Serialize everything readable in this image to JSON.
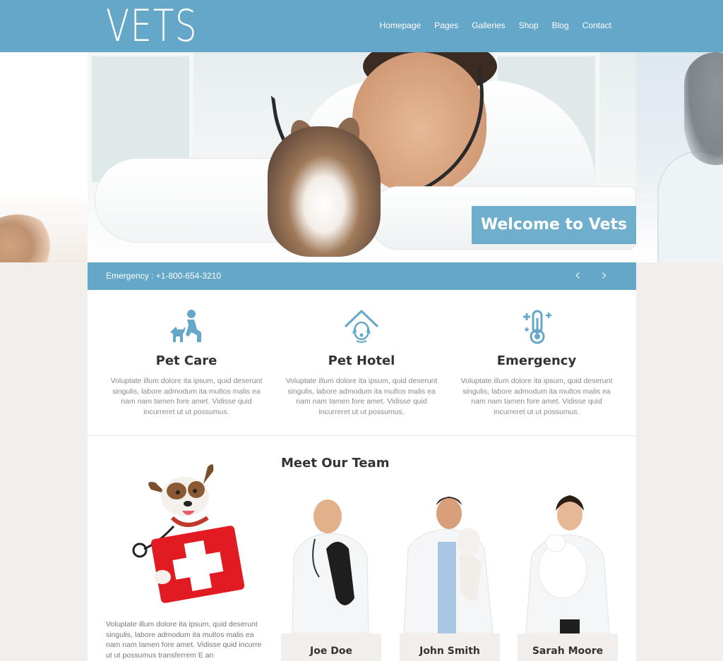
{
  "header": {
    "logo": "VETS",
    "nav": [
      "Homepage",
      "Pages",
      "Galleries",
      "Shop",
      "Blog",
      "Contact"
    ]
  },
  "hero": {
    "welcome": "Welcome to Vets"
  },
  "bar": {
    "phone": "Emergency : +1-800-654-3210",
    "prev_icon": "chevron-left-icon",
    "next_icon": "chevron-right-icon"
  },
  "services": [
    {
      "title": "Pet Care",
      "icon": "person-with-dog-icon",
      "text": "Voluptate illum dolore ita ipsum, quid deserunt singulis, labore admodum ita multos malis ea nam nam tamen fore amet. Vidisse quid incurreret ut ut possumus."
    },
    {
      "title": "Pet Hotel",
      "icon": "dog-house-icon",
      "text": "Voluptate illum dolore ita ipsum, quid deserunt singulis, labore admodum ita multos malis ea nam nam tamen fore amet. Vidisse quid incurreret ut ut possumus."
    },
    {
      "title": "Emergency",
      "icon": "thermometer-icon",
      "text": "Voluptate illum dolore ita ipsum, quid deserunt singulis, labore admodum ita multos malis ea nam nam tamen fore amet. Vidisse quid incurreret ut ut possumus."
    }
  ],
  "team": {
    "title": "Meet Our Team",
    "text": "Voluptate illum dolore ita ipsum, quid deserunt singulis, labore admodum ita multos malis ea nam nam tamen fore amet. Vidisse quid incurre ut ut possumus transferrem E an",
    "members": [
      {
        "name": "Joe Doe"
      },
      {
        "name": "John Smith"
      },
      {
        "name": "Sarah Moore"
      }
    ]
  },
  "colors": {
    "accent": "#64a7c9",
    "background": "#f1eeec",
    "card": "#ffffff",
    "heading": "#333333",
    "body_text": "#8a8a8a"
  }
}
